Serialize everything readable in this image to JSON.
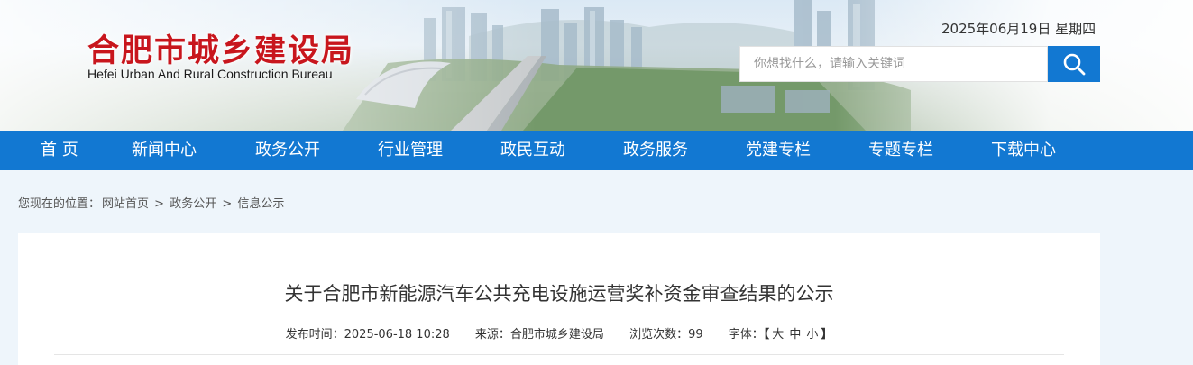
{
  "header": {
    "site_name_cn": "合肥市城乡建设局",
    "site_name_en": "Hefei Urban And Rural Construction Bureau",
    "date": "2025年06月19日 星期四",
    "search_placeholder": "你想找什么，请输入关键词",
    "search_icon": "search-icon"
  },
  "nav": {
    "items": [
      {
        "label": "首  页"
      },
      {
        "label": "新闻中心"
      },
      {
        "label": "政务公开"
      },
      {
        "label": "行业管理"
      },
      {
        "label": "政民互动"
      },
      {
        "label": "政务服务"
      },
      {
        "label": "党建专栏"
      },
      {
        "label": "专题专栏"
      },
      {
        "label": "下载中心"
      }
    ]
  },
  "breadcrumb": {
    "prefix": "您现在的位置：",
    "items": [
      "网站首页",
      "政务公开",
      "信息公示"
    ],
    "separator": ">"
  },
  "article": {
    "title": "关于合肥市新能源汽车公共充电设施运营奖补资金审查结果的公示",
    "publish_time": "发布时间：2025-06-18 10:28",
    "source": "来源：合肥市城乡建设局",
    "views": "浏览次数：99",
    "font_label": "字体：",
    "font_open": "【",
    "font_large": "大",
    "font_medium": "中",
    "font_small": "小",
    "font_close": "】"
  },
  "colors": {
    "brand_blue": "#1278d2",
    "logo_red": "#c8161d"
  }
}
